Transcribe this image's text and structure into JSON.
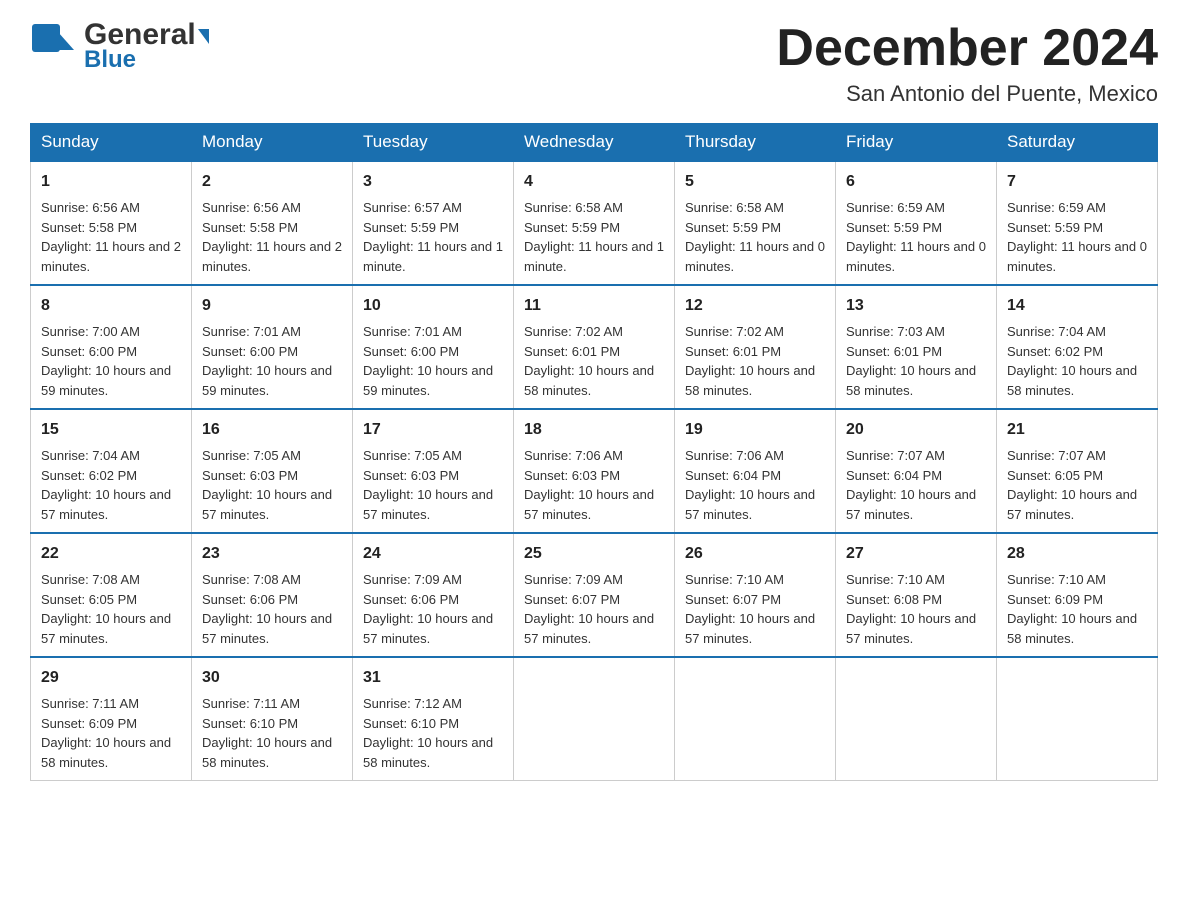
{
  "logo": {
    "general": "General",
    "blue": "Blue"
  },
  "header": {
    "month": "December 2024",
    "location": "San Antonio del Puente, Mexico"
  },
  "days_of_week": [
    "Sunday",
    "Monday",
    "Tuesday",
    "Wednesday",
    "Thursday",
    "Friday",
    "Saturday"
  ],
  "weeks": [
    [
      {
        "day": "1",
        "sunrise": "6:56 AM",
        "sunset": "5:58 PM",
        "daylight": "11 hours and 2 minutes."
      },
      {
        "day": "2",
        "sunrise": "6:56 AM",
        "sunset": "5:58 PM",
        "daylight": "11 hours and 2 minutes."
      },
      {
        "day": "3",
        "sunrise": "6:57 AM",
        "sunset": "5:59 PM",
        "daylight": "11 hours and 1 minute."
      },
      {
        "day": "4",
        "sunrise": "6:58 AM",
        "sunset": "5:59 PM",
        "daylight": "11 hours and 1 minute."
      },
      {
        "day": "5",
        "sunrise": "6:58 AM",
        "sunset": "5:59 PM",
        "daylight": "11 hours and 0 minutes."
      },
      {
        "day": "6",
        "sunrise": "6:59 AM",
        "sunset": "5:59 PM",
        "daylight": "11 hours and 0 minutes."
      },
      {
        "day": "7",
        "sunrise": "6:59 AM",
        "sunset": "5:59 PM",
        "daylight": "11 hours and 0 minutes."
      }
    ],
    [
      {
        "day": "8",
        "sunrise": "7:00 AM",
        "sunset": "6:00 PM",
        "daylight": "10 hours and 59 minutes."
      },
      {
        "day": "9",
        "sunrise": "7:01 AM",
        "sunset": "6:00 PM",
        "daylight": "10 hours and 59 minutes."
      },
      {
        "day": "10",
        "sunrise": "7:01 AM",
        "sunset": "6:00 PM",
        "daylight": "10 hours and 59 minutes."
      },
      {
        "day": "11",
        "sunrise": "7:02 AM",
        "sunset": "6:01 PM",
        "daylight": "10 hours and 58 minutes."
      },
      {
        "day": "12",
        "sunrise": "7:02 AM",
        "sunset": "6:01 PM",
        "daylight": "10 hours and 58 minutes."
      },
      {
        "day": "13",
        "sunrise": "7:03 AM",
        "sunset": "6:01 PM",
        "daylight": "10 hours and 58 minutes."
      },
      {
        "day": "14",
        "sunrise": "7:04 AM",
        "sunset": "6:02 PM",
        "daylight": "10 hours and 58 minutes."
      }
    ],
    [
      {
        "day": "15",
        "sunrise": "7:04 AM",
        "sunset": "6:02 PM",
        "daylight": "10 hours and 57 minutes."
      },
      {
        "day": "16",
        "sunrise": "7:05 AM",
        "sunset": "6:03 PM",
        "daylight": "10 hours and 57 minutes."
      },
      {
        "day": "17",
        "sunrise": "7:05 AM",
        "sunset": "6:03 PM",
        "daylight": "10 hours and 57 minutes."
      },
      {
        "day": "18",
        "sunrise": "7:06 AM",
        "sunset": "6:03 PM",
        "daylight": "10 hours and 57 minutes."
      },
      {
        "day": "19",
        "sunrise": "7:06 AM",
        "sunset": "6:04 PM",
        "daylight": "10 hours and 57 minutes."
      },
      {
        "day": "20",
        "sunrise": "7:07 AM",
        "sunset": "6:04 PM",
        "daylight": "10 hours and 57 minutes."
      },
      {
        "day": "21",
        "sunrise": "7:07 AM",
        "sunset": "6:05 PM",
        "daylight": "10 hours and 57 minutes."
      }
    ],
    [
      {
        "day": "22",
        "sunrise": "7:08 AM",
        "sunset": "6:05 PM",
        "daylight": "10 hours and 57 minutes."
      },
      {
        "day": "23",
        "sunrise": "7:08 AM",
        "sunset": "6:06 PM",
        "daylight": "10 hours and 57 minutes."
      },
      {
        "day": "24",
        "sunrise": "7:09 AM",
        "sunset": "6:06 PM",
        "daylight": "10 hours and 57 minutes."
      },
      {
        "day": "25",
        "sunrise": "7:09 AM",
        "sunset": "6:07 PM",
        "daylight": "10 hours and 57 minutes."
      },
      {
        "day": "26",
        "sunrise": "7:10 AM",
        "sunset": "6:07 PM",
        "daylight": "10 hours and 57 minutes."
      },
      {
        "day": "27",
        "sunrise": "7:10 AM",
        "sunset": "6:08 PM",
        "daylight": "10 hours and 57 minutes."
      },
      {
        "day": "28",
        "sunrise": "7:10 AM",
        "sunset": "6:09 PM",
        "daylight": "10 hours and 58 minutes."
      }
    ],
    [
      {
        "day": "29",
        "sunrise": "7:11 AM",
        "sunset": "6:09 PM",
        "daylight": "10 hours and 58 minutes."
      },
      {
        "day": "30",
        "sunrise": "7:11 AM",
        "sunset": "6:10 PM",
        "daylight": "10 hours and 58 minutes."
      },
      {
        "day": "31",
        "sunrise": "7:12 AM",
        "sunset": "6:10 PM",
        "daylight": "10 hours and 58 minutes."
      },
      null,
      null,
      null,
      null
    ]
  ],
  "labels": {
    "sunrise": "Sunrise:",
    "sunset": "Sunset:",
    "daylight": "Daylight:"
  }
}
